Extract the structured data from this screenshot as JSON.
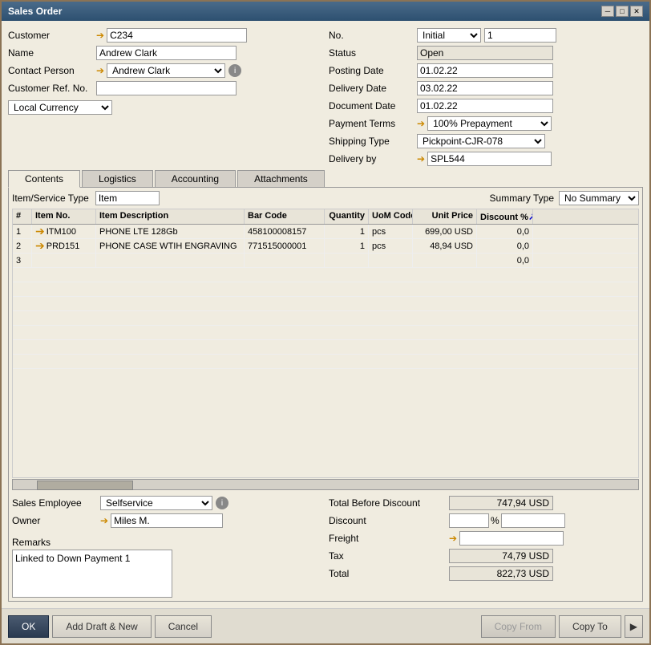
{
  "window": {
    "title": "Sales Order",
    "buttons": {
      "minimize": "─",
      "maximize": "□",
      "close": "✕"
    }
  },
  "form": {
    "left": {
      "customer_label": "Customer",
      "customer_value": "C234",
      "name_label": "Name",
      "name_value": "Andrew Clark",
      "contact_person_label": "Contact Person",
      "contact_person_value": "Andrew Clark",
      "customer_ref_label": "Customer Ref. No.",
      "customer_ref_value": "",
      "currency_value": "Local Currency"
    },
    "right": {
      "no_label": "No.",
      "no_status": "Initial",
      "no_value": "1",
      "status_label": "Status",
      "status_value": "Open",
      "posting_date_label": "Posting Date",
      "posting_date_value": "01.02.22",
      "delivery_date_label": "Delivery Date",
      "delivery_date_value": "03.02.22",
      "document_date_label": "Document Date",
      "document_date_value": "01.02.22",
      "payment_terms_label": "Payment Terms",
      "payment_terms_value": "100% Prepayment",
      "shipping_type_label": "Shipping Type",
      "shipping_type_value": "Pickpoint-CJR-078",
      "delivery_by_label": "Delivery by",
      "delivery_by_value": "SPL544"
    }
  },
  "tabs": {
    "items": [
      "Contents",
      "Logistics",
      "Accounting",
      "Attachments"
    ],
    "active": "Contents"
  },
  "contents": {
    "item_type_label": "Item/Service Type",
    "item_type_value": "Item",
    "summary_type_label": "Summary Type",
    "summary_type_value": "No Summary",
    "columns": [
      "#",
      "Item No.",
      "Item Description",
      "Bar Code",
      "Quantity",
      "UoM Code",
      "Unit Price",
      "Discount %"
    ],
    "rows": [
      {
        "num": "1",
        "item_no": "ITM100",
        "description": "PHONE LTE 128Gb",
        "barcode": "458100008157",
        "quantity": "1",
        "uom": "pcs",
        "unit_price": "699,00 USD",
        "discount": "0,0"
      },
      {
        "num": "2",
        "item_no": "PRD151",
        "description": "PHONE CASE WTIH ENGRAVING",
        "barcode": "771515000001",
        "quantity": "1",
        "uom": "pcs",
        "unit_price": "48,94 USD",
        "discount": "0,0"
      },
      {
        "num": "3",
        "item_no": "",
        "description": "",
        "barcode": "",
        "quantity": "",
        "uom": "",
        "unit_price": "",
        "discount": "0,0"
      }
    ]
  },
  "bottom": {
    "sales_employee_label": "Sales Employee",
    "sales_employee_value": "Selfservice",
    "owner_label": "Owner",
    "owner_value": "Miles M.",
    "remarks_label": "Remarks",
    "remarks_value": "Linked to Down Payment 1"
  },
  "totals": {
    "total_before_discount_label": "Total Before Discount",
    "total_before_discount_value": "747,94 USD",
    "discount_label": "Discount",
    "discount_value": "",
    "percent_sign": "%",
    "discount_amount": "",
    "freight_label": "Freight",
    "freight_value": "",
    "tax_label": "Tax",
    "tax_value": "74,79 USD",
    "total_label": "Total",
    "total_value": "822,73 USD"
  },
  "footer": {
    "ok_label": "OK",
    "add_draft_label": "Add Draft & New",
    "cancel_label": "Cancel",
    "copy_from_label": "Copy From",
    "copy_to_label": "Copy To"
  }
}
